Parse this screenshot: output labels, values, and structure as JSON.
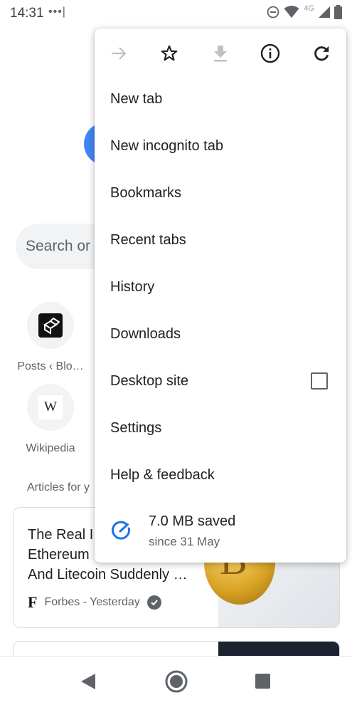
{
  "status_bar": {
    "time": "14:31",
    "notification_dots": "•••|",
    "network_label": "4G",
    "icons": [
      "do-not-disturb-icon",
      "wifi-icon",
      "signal-icon",
      "battery-icon"
    ]
  },
  "new_tab_page": {
    "search_placeholder": "Search or",
    "tiles": [
      {
        "label": "Posts ‹ Blo…",
        "icon": "blockchain-cube-icon"
      },
      {
        "label": "Wikipedia",
        "icon": "wikipedia-w-icon",
        "glyph": "W"
      }
    ],
    "articles_heading": "Articles for y",
    "article": {
      "title": "The Real I Ethereum And Litecoin Suddenly …",
      "title_lines": [
        "The Real I",
        "Ethereum",
        "And Litecoin Suddenly …"
      ],
      "source_logo": "F",
      "source": "Forbes - Yesterday",
      "coin_glyph": "B"
    }
  },
  "overflow_menu": {
    "toolbar": [
      "forward-icon",
      "bookmark-star-icon",
      "download-icon",
      "page-info-icon",
      "reload-icon"
    ],
    "items": [
      {
        "label": "New tab"
      },
      {
        "label": "New incognito tab"
      },
      {
        "label": "Bookmarks"
      },
      {
        "label": "Recent tabs"
      },
      {
        "label": "History"
      },
      {
        "label": "Downloads"
      },
      {
        "label": "Desktop site",
        "checked": false
      },
      {
        "label": "Settings"
      },
      {
        "label": "Help & feedback"
      }
    ],
    "data_saver": {
      "amount": "7.0 MB saved",
      "since": "since 31 May"
    }
  },
  "navigation_bar": [
    "back-icon",
    "home-icon",
    "recents-icon"
  ],
  "colors": {
    "accent_blue": "#1a73e8",
    "icon_gray": "#5f6368",
    "text": "#202124"
  }
}
